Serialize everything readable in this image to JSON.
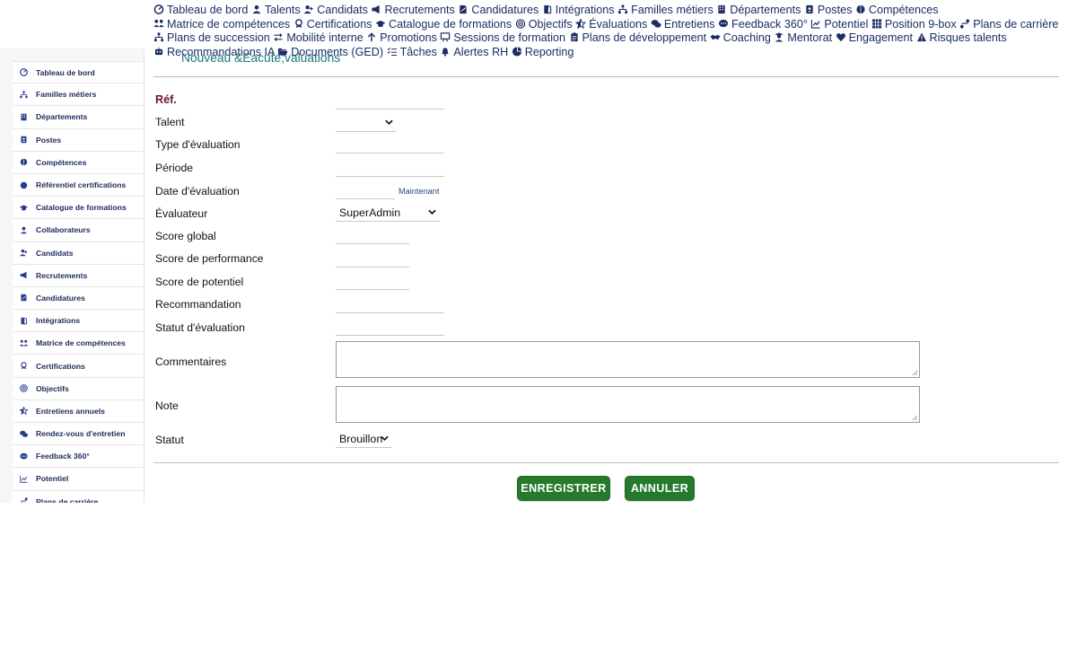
{
  "topnav": {
    "links": [
      {
        "label": "Tableau de bord",
        "icon": "dashboard-icon"
      },
      {
        "label": "Talents",
        "icon": "user-tie-icon"
      },
      {
        "label": "Candidats",
        "icon": "user-plus-icon"
      },
      {
        "label": "Recrutements",
        "icon": "bullhorn-icon"
      },
      {
        "label": "Candidatures",
        "icon": "file-signature-icon"
      },
      {
        "label": "Intégrations",
        "icon": "door-open-icon"
      },
      {
        "label": "Familles métiers",
        "icon": "sitemap-icon"
      },
      {
        "label": "Départements",
        "icon": "building-icon"
      },
      {
        "label": "Postes",
        "icon": "id-badge-icon"
      },
      {
        "label": "Compétences",
        "icon": "brain-icon"
      },
      {
        "label": "Matrice de compétences",
        "icon": "users-network-icon"
      },
      {
        "label": "Certifications",
        "icon": "award-icon"
      },
      {
        "label": "Catalogue de formations",
        "icon": "graduation-cap-icon"
      },
      {
        "label": "Objectifs",
        "icon": "bullseye-icon"
      },
      {
        "label": "Évaluations",
        "icon": "star-half-icon"
      },
      {
        "label": "Entretiens",
        "icon": "comments-icon"
      },
      {
        "label": "Feedback 360°",
        "icon": "comment-dots-icon"
      },
      {
        "label": "Potentiel",
        "icon": "chart-line-icon"
      },
      {
        "label": "Position 9-box",
        "icon": "grid-icon"
      },
      {
        "label": "Plans de carrière",
        "icon": "route-icon"
      },
      {
        "label": "Plans de succession",
        "icon": "sitemap-icon"
      },
      {
        "label": "Mobilité interne",
        "icon": "exchange-icon"
      },
      {
        "label": "Promotions",
        "icon": "arrow-up-icon"
      },
      {
        "label": "Sessions de formation",
        "icon": "chalkboard-icon"
      },
      {
        "label": "Plans de développement",
        "icon": "clipboard-icon"
      },
      {
        "label": "Coaching",
        "icon": "handshake-icon"
      },
      {
        "label": "Mentorat",
        "icon": "user-graduate-icon"
      },
      {
        "label": "Engagement",
        "icon": "heart-icon"
      },
      {
        "label": "Risques talents",
        "icon": "warning-icon"
      },
      {
        "label": "Recommandations IA",
        "icon": "robot-icon"
      },
      {
        "label": "Documents (GED)",
        "icon": "folder-open-icon"
      },
      {
        "label": "Tâches",
        "icon": "list-check-icon"
      },
      {
        "label": "Alertes RH",
        "icon": "bell-icon"
      },
      {
        "label": "Reporting",
        "icon": "pie-chart-icon"
      }
    ]
  },
  "page": {
    "subtitle": "Nouveau &Eacute;valuations"
  },
  "sidebar": {
    "items": [
      {
        "label": "Tableau de bord",
        "icon": "dashboard-icon"
      },
      {
        "label": "Familles métiers",
        "icon": "sitemap-icon"
      },
      {
        "label": "Départements",
        "icon": "building-icon"
      },
      {
        "label": "Postes",
        "icon": "id-badge-icon"
      },
      {
        "label": "Compétences",
        "icon": "brain-icon"
      },
      {
        "label": "Référentiel certifications",
        "icon": "certificate-icon"
      },
      {
        "label": "Catalogue de formations",
        "icon": "graduation-cap-icon"
      },
      {
        "label": "Collaborateurs",
        "icon": "user-icon"
      },
      {
        "label": "Candidats",
        "icon": "user-plus-icon"
      },
      {
        "label": "Recrutements",
        "icon": "bullhorn-icon"
      },
      {
        "label": "Candidatures",
        "icon": "file-signature-icon"
      },
      {
        "label": "Intégrations",
        "icon": "door-open-icon"
      },
      {
        "label": "Matrice de compétences",
        "icon": "users-network-icon"
      },
      {
        "label": "Certifications",
        "icon": "award-icon"
      },
      {
        "label": "Objectifs",
        "icon": "bullseye-icon"
      },
      {
        "label": "Entretiens annuels",
        "icon": "star-half-icon"
      },
      {
        "label": "Rendez-vous d'entretien",
        "icon": "comments-icon"
      },
      {
        "label": "Feedback 360°",
        "icon": "comment-dots-icon"
      },
      {
        "label": "Potentiel",
        "icon": "chart-line-icon"
      },
      {
        "label": "Plans de carrière",
        "icon": "route-icon"
      }
    ]
  },
  "form": {
    "ref_label": "Réf.",
    "talent_label": "Talent",
    "talent_value": "",
    "type_label": "Type d'évaluation",
    "periode_label": "Période",
    "date_label": "Date d'évaluation",
    "now_link": "Maintenant",
    "evaluateur_label": "Évaluateur",
    "evaluateur_value": "SuperAdmin",
    "score_global_label": "Score global",
    "score_perf_label": "Score de performance",
    "score_pot_label": "Score de potentiel",
    "recommandation_label": "Recommandation",
    "statut_eval_label": "Statut d'évaluation",
    "commentaires_label": "Commentaires",
    "note_label": "Note",
    "statut_label": "Statut",
    "statut_value": "Brouillon"
  },
  "actions": {
    "save": "ENREGISTRER",
    "cancel": "ANNULER"
  },
  "colors": {
    "nav_text": "#1b2c67",
    "subtitle": "#137a78",
    "ref_label": "#6b1233",
    "button_bg": "#267a2c"
  }
}
